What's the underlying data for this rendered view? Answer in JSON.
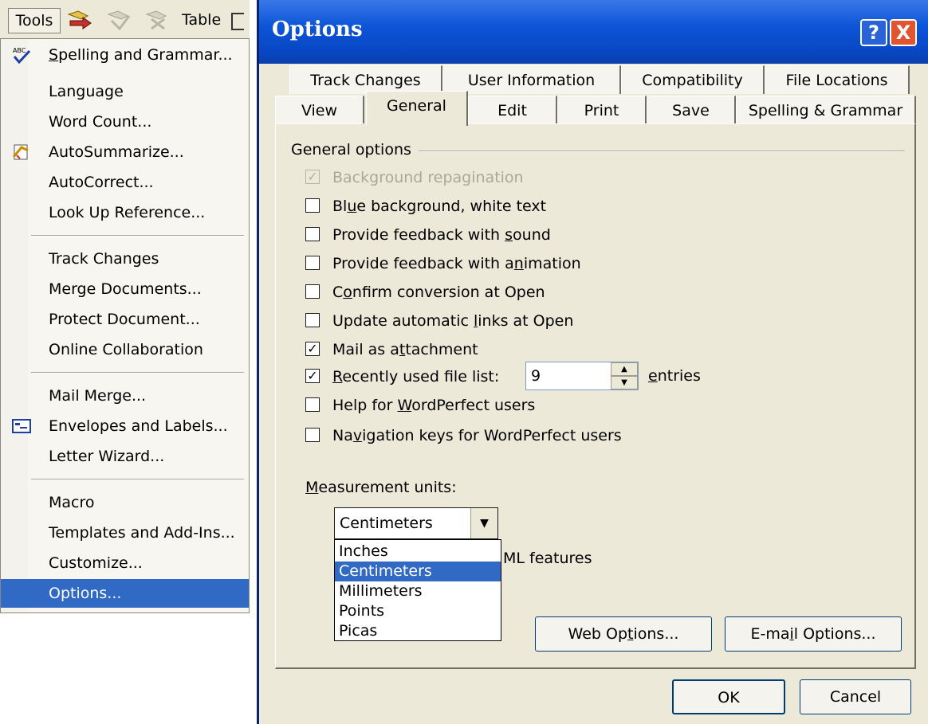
{
  "menu": {
    "tools_title": "Tools",
    "table_title": "Table",
    "items": [
      {
        "label": "Spelling and Grammar...",
        "icon": "spelling-icon"
      },
      {
        "label": "Language"
      },
      {
        "label": "Word Count..."
      },
      {
        "label": "AutoSummarize...",
        "icon": "autosummarize-icon"
      },
      {
        "label": "AutoCorrect..."
      },
      {
        "label": "Look Up Reference..."
      },
      {
        "label": "Track Changes"
      },
      {
        "label": "Merge Documents..."
      },
      {
        "label": "Protect Document..."
      },
      {
        "label": "Online Collaboration"
      },
      {
        "label": "Mail Merge..."
      },
      {
        "label": "Envelopes and Labels...",
        "icon": "envelope-icon"
      },
      {
        "label": "Letter Wizard..."
      },
      {
        "label": "Macro"
      },
      {
        "label": "Templates and Add-Ins..."
      },
      {
        "label": "Customize..."
      },
      {
        "label": "Options...",
        "selected": true
      }
    ]
  },
  "dialog": {
    "title": "Options",
    "help_label": "?",
    "close_label": "X",
    "tabs_back": [
      "Track Changes",
      "User Information",
      "Compatibility",
      "File Locations"
    ],
    "tabs_front": [
      "View",
      "General",
      "Edit",
      "Print",
      "Save",
      "Spelling & Grammar"
    ],
    "active_tab": "General",
    "group_label": "General options",
    "options": [
      {
        "label": "Background repagination",
        "checked": true,
        "disabled": true
      },
      {
        "label": "Blue background, white text",
        "checked": false
      },
      {
        "label": "Provide feedback with sound",
        "checked": false
      },
      {
        "label": "Provide feedback with animation",
        "checked": false
      },
      {
        "label": "Confirm conversion at Open",
        "checked": false
      },
      {
        "label": "Update automatic links at Open",
        "checked": false
      },
      {
        "label": "Mail as attachment",
        "checked": true
      },
      {
        "label": "Recently used file list:",
        "checked": true
      },
      {
        "label": "Help for WordPerfect users",
        "checked": false
      },
      {
        "label": "Navigation keys for WordPerfect users",
        "checked": false
      }
    ],
    "recent_files_value": "9",
    "entries_label": "entries",
    "measurement_label": "Measurement units:",
    "measurement_value": "Centimeters",
    "measurement_options": [
      "Inches",
      "Centimeters",
      "Millimeters",
      "Points",
      "Picas"
    ],
    "measurement_selected": "Centimeters",
    "partial_text": "ML features",
    "web_options_label": "Web Options...",
    "email_options_label": "E-mail Options...",
    "ok_label": "OK",
    "cancel_label": "Cancel",
    "colors": {
      "titlebar": "#0a55d8",
      "selection": "#316ac5",
      "dialog_bg": "#ece9d8"
    }
  }
}
